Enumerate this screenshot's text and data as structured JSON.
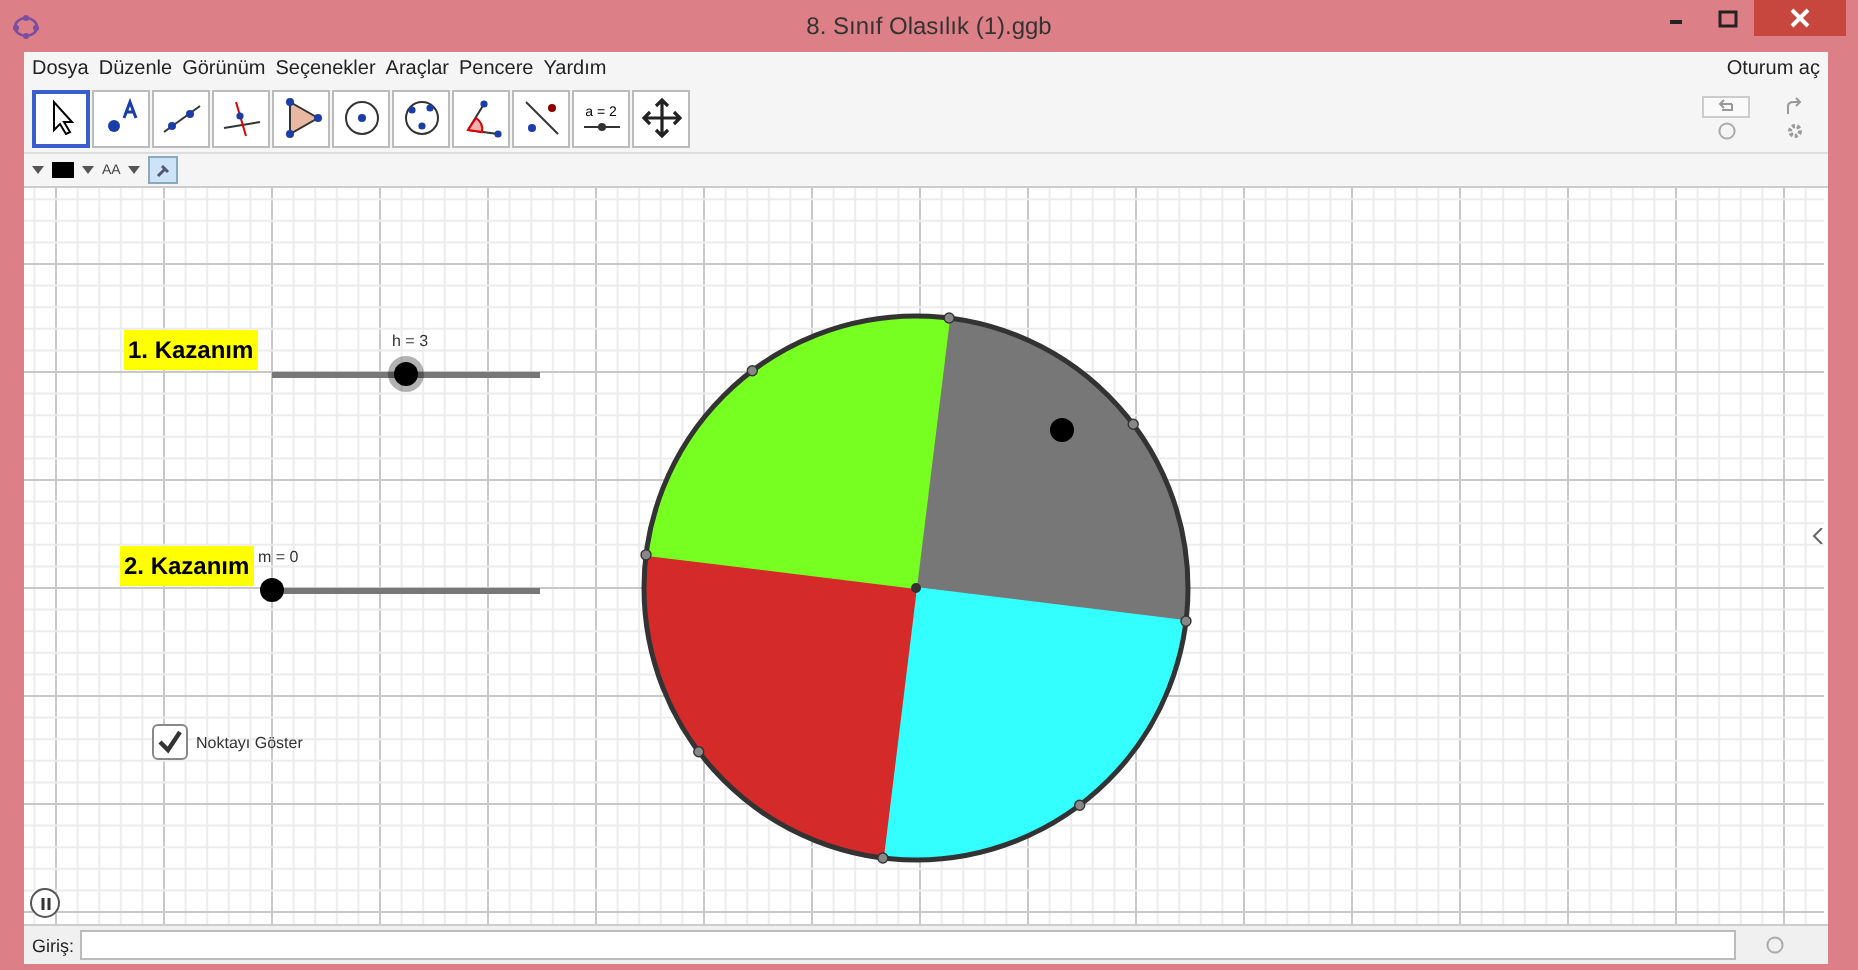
{
  "window": {
    "title": "8. Sınıf Olasılık (1).ggb"
  },
  "menu": [
    "Dosya",
    "Düzenle",
    "Görünüm",
    "Seçenekler",
    "Araçlar",
    "Pencere",
    "Yardım"
  ],
  "sign_in": "Oturum aç",
  "tools": [
    {
      "kind": "move",
      "selected": true
    },
    {
      "kind": "point",
      "selected": false
    },
    {
      "kind": "line",
      "selected": false
    },
    {
      "kind": "perpendicular",
      "selected": false
    },
    {
      "kind": "polygon",
      "selected": false
    },
    {
      "kind": "circle",
      "selected": false
    },
    {
      "kind": "circle3",
      "selected": false
    },
    {
      "kind": "angle",
      "selected": false
    },
    {
      "kind": "reflect",
      "selected": false
    },
    {
      "kind": "slider",
      "selected": false,
      "label": "a = 2"
    },
    {
      "kind": "move_view",
      "selected": false
    }
  ],
  "style_bar": {
    "color": "#000000",
    "font_label": "AA"
  },
  "sliders": [
    {
      "label": "1. Kazanım",
      "value_label": "h = 3",
      "level": 0.5
    },
    {
      "label": "2. Kazanım",
      "value_label": "m = 0",
      "level": 0
    }
  ],
  "checkbox": {
    "label": "Noktayı Göster",
    "checked": true
  },
  "sectors": [
    {
      "color": "#777777"
    },
    {
      "color": "#33ffff"
    },
    {
      "color": "#d42a2a"
    },
    {
      "color": "#77ff22"
    }
  ],
  "input_bar": {
    "label": "Giriş:"
  }
}
